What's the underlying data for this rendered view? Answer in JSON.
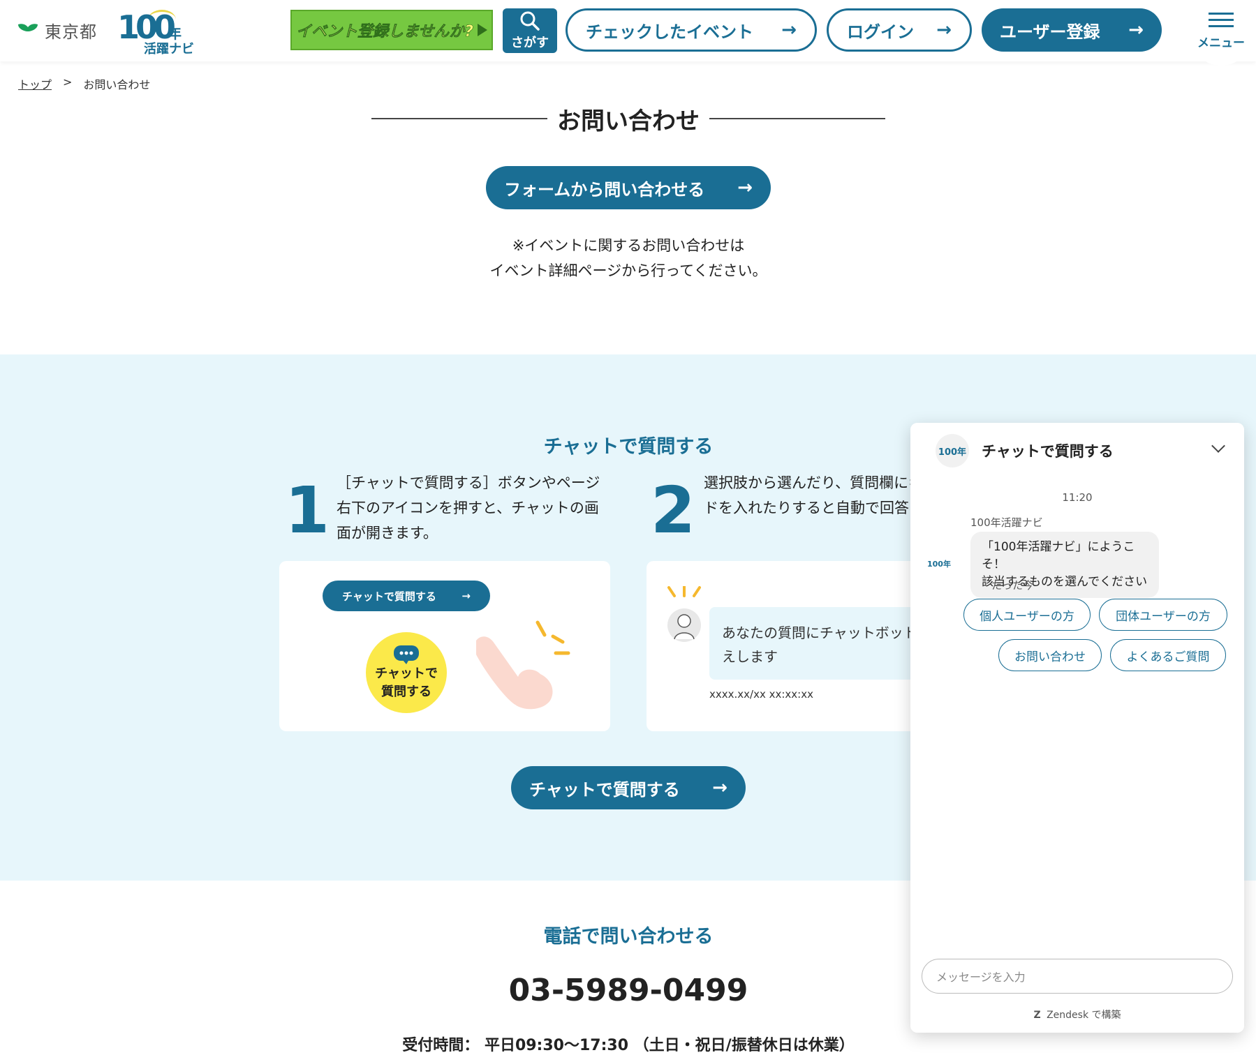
{
  "header": {
    "tokyo_label": "東京都",
    "logo_number": "100",
    "logo_nen": "年",
    "logo_navi": "活躍ナビ",
    "banner": "イベント登録しませんか?",
    "search": "さがす",
    "checked_events": "チェックしたイベント",
    "login": "ログイン",
    "register": "ユーザー登録",
    "menu": "メニュー",
    "arrow": "→"
  },
  "breadcrumb": {
    "top": "トップ",
    "sep": ">",
    "current": "お問い合わせ"
  },
  "page_title": "お問い合わせ",
  "form_button": "フォームから問い合わせる",
  "note_line1": "※イベントに関するお問い合わせは",
  "note_line2": "イベント詳細ページから行ってください。",
  "chat_section": {
    "title": "チャットで質問する",
    "step1": {
      "num": "1",
      "text": "［チャットで質問する］ボタンやページ右下のアイコンを押すと、チャットの画面が開きます。"
    },
    "step2": {
      "num": "2",
      "text": "選択肢から選んだり、質問欄にキーワードを入れたりすると自動で回答します。"
    },
    "card1": {
      "mini_button": "チャットで質問する",
      "icon_line1": "チャットで",
      "icon_line2": "質問する"
    },
    "card2": {
      "bubble": "あなたの質問にチャットボットがお答えします",
      "timestamp": "xxxx.xx/xx xx:xx:xx"
    },
    "button": "チャットで質問する"
  },
  "phone_section": {
    "title": "電話で問い合わせる",
    "number": "03-5989-0499",
    "hours": "受付時間： 平日09:30〜17:30 （土日・祝日/振替休日は休業）"
  },
  "widget": {
    "title": "チャットで質問する",
    "logo": "100年",
    "time": "11:20",
    "sender": "100年活躍ナビ",
    "message_line1": "「100年活躍ナビ」にようこそ！",
    "message_line2": "該当するものを選んでください",
    "sent": "たった今",
    "options": [
      "個人ユーザーの方",
      "団体ユーザーの方",
      "お問い合わせ",
      "よくあるご質問"
    ],
    "input_placeholder": "メッセージを入力",
    "powered": "Zendesk で構築"
  },
  "colors": {
    "primary": "#1a6e94",
    "light_bg": "#e7f6fb",
    "banner_green": "#76c841",
    "yellow": "#fbe94a"
  }
}
